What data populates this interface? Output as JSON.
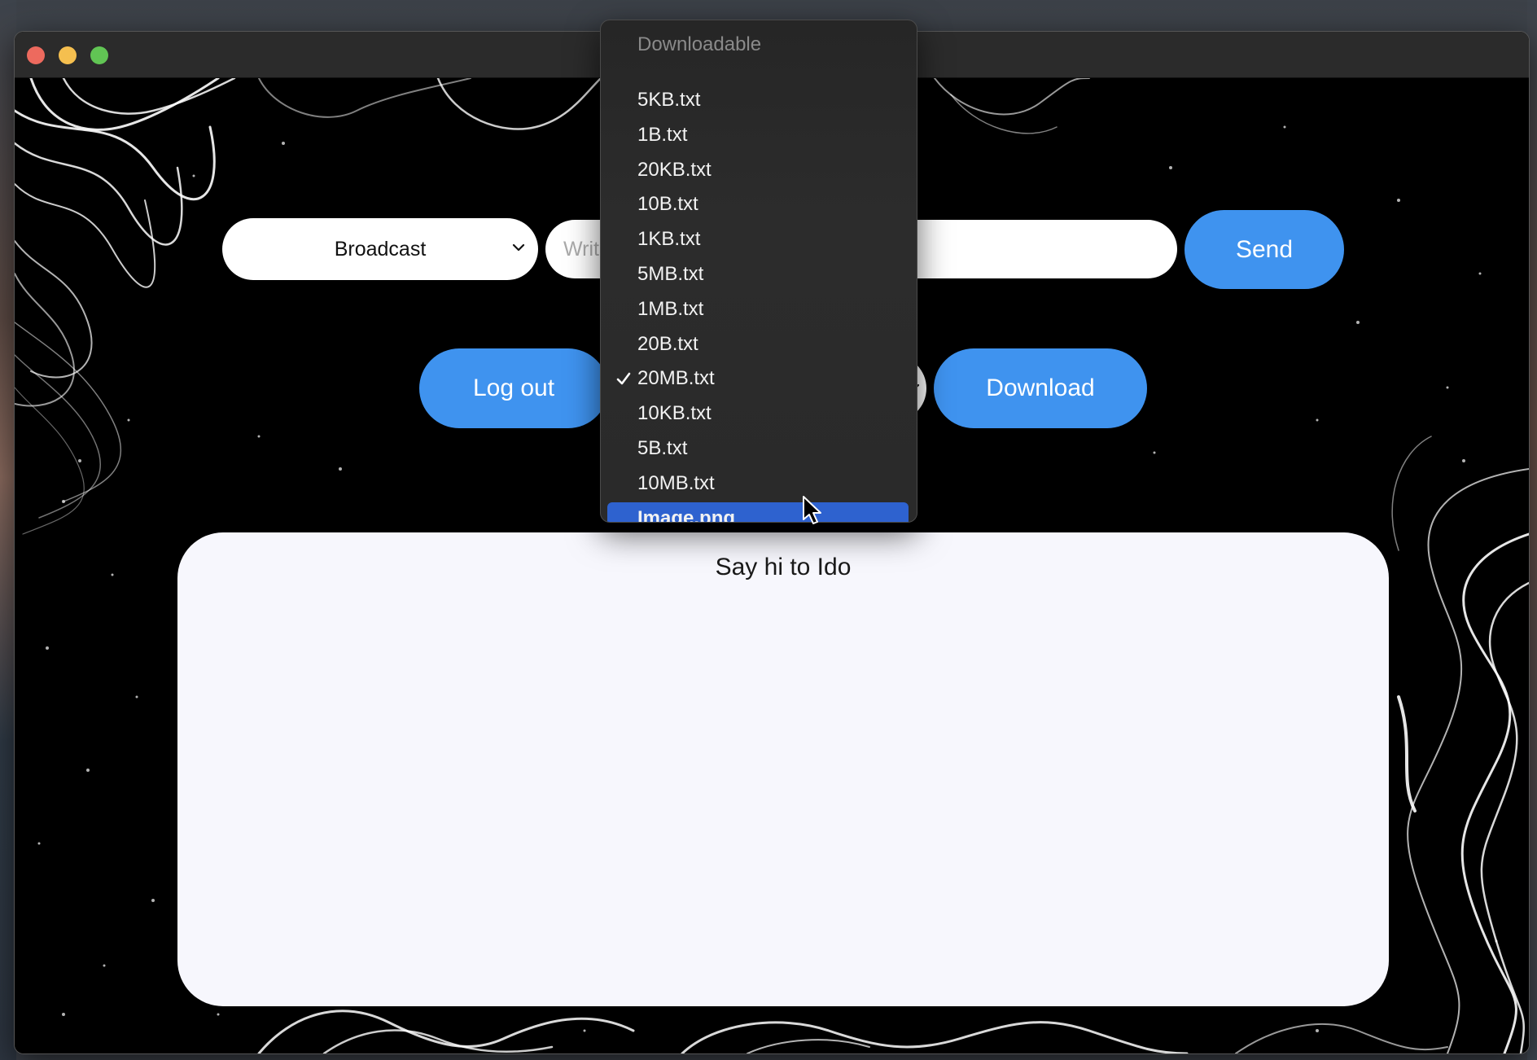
{
  "window": {
    "traffic_lights": [
      "close",
      "minimize",
      "maximize"
    ]
  },
  "toolbar": {
    "recipient_select_value": "Broadcast",
    "message_placeholder": "Write a message",
    "send_label": "Send",
    "logout_label": "Log out",
    "download_label": "Download"
  },
  "file_menu": {
    "header": "Downloadable",
    "items": [
      {
        "label": "5KB.txt",
        "checked": false,
        "highlighted": false
      },
      {
        "label": "1B.txt",
        "checked": false,
        "highlighted": false
      },
      {
        "label": "20KB.txt",
        "checked": false,
        "highlighted": false
      },
      {
        "label": "10B.txt",
        "checked": false,
        "highlighted": false
      },
      {
        "label": "1KB.txt",
        "checked": false,
        "highlighted": false
      },
      {
        "label": "5MB.txt",
        "checked": false,
        "highlighted": false
      },
      {
        "label": "1MB.txt",
        "checked": false,
        "highlighted": false
      },
      {
        "label": "20B.txt",
        "checked": false,
        "highlighted": false
      },
      {
        "label": "20MB.txt",
        "checked": true,
        "highlighted": false
      },
      {
        "label": "10KB.txt",
        "checked": false,
        "highlighted": false
      },
      {
        "label": "5B.txt",
        "checked": false,
        "highlighted": false
      },
      {
        "label": "10MB.txt",
        "checked": false,
        "highlighted": false
      },
      {
        "label": "Image.png",
        "checked": false,
        "highlighted": true
      }
    ]
  },
  "chat": {
    "greeting": "Say hi to Ido"
  },
  "colors": {
    "accent_button": "#3f93ef",
    "menu_highlight": "#2e62cf",
    "panel_bg": "#f7f7fd"
  }
}
